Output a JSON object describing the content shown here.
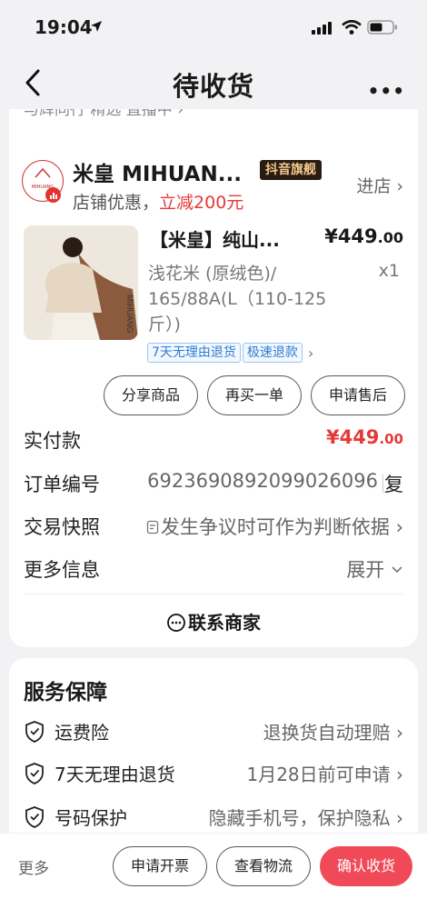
{
  "status_bar": {
    "time": "19:04"
  },
  "nav": {
    "title": "待收货"
  },
  "partial_top_row": "与辉同行 精选  直播中 ›",
  "shop": {
    "logo_text": "MIHUANG",
    "name": "米皇 MIHUAN...",
    "badge": "抖音旗舰",
    "promo_prefix": "店铺优惠，",
    "promo_value": "立减200元",
    "enter_label": "进店 ›"
  },
  "product": {
    "title": "【米皇】纯山...",
    "price_main": "¥449",
    "price_decimal": ".00",
    "spec": "浅花米 (原绒色)/ 165/88A(L（110-125斤）)",
    "qty": "x1",
    "tags": [
      "7天无理由退货",
      "极速退款"
    ],
    "buttons": [
      "分享商品",
      "再买一单",
      "申请售后"
    ]
  },
  "order": {
    "paid_label": "实付款",
    "paid_main": "¥449",
    "paid_decimal": ".00",
    "order_no_label": "订单编号",
    "order_no": "6923690892099026096",
    "copy_label": "复",
    "snapshot_label": "交易快照",
    "snapshot_value": "发生争议时可作为判断依据 ›",
    "more_info_label": "更多信息",
    "more_info_value": "展开",
    "contact_label": "联系商家"
  },
  "service": {
    "title": "服务保障",
    "items": [
      {
        "label": "运费险",
        "value": "退换货自动理赔 ›"
      },
      {
        "label": "7天无理由退货",
        "value": "1月28日前可申请 ›"
      },
      {
        "label": "号码保护",
        "value": "隐藏手机号，保护隐私 ›"
      }
    ]
  },
  "bottom_bar": {
    "more": "更多",
    "invoice": "申请开票",
    "logistics": "查看物流",
    "confirm": "确认收货"
  },
  "colors": {
    "accent_red": "#e53a3a",
    "confirm_button": "#f04a58",
    "tag_blue": "#2f7dd0"
  }
}
